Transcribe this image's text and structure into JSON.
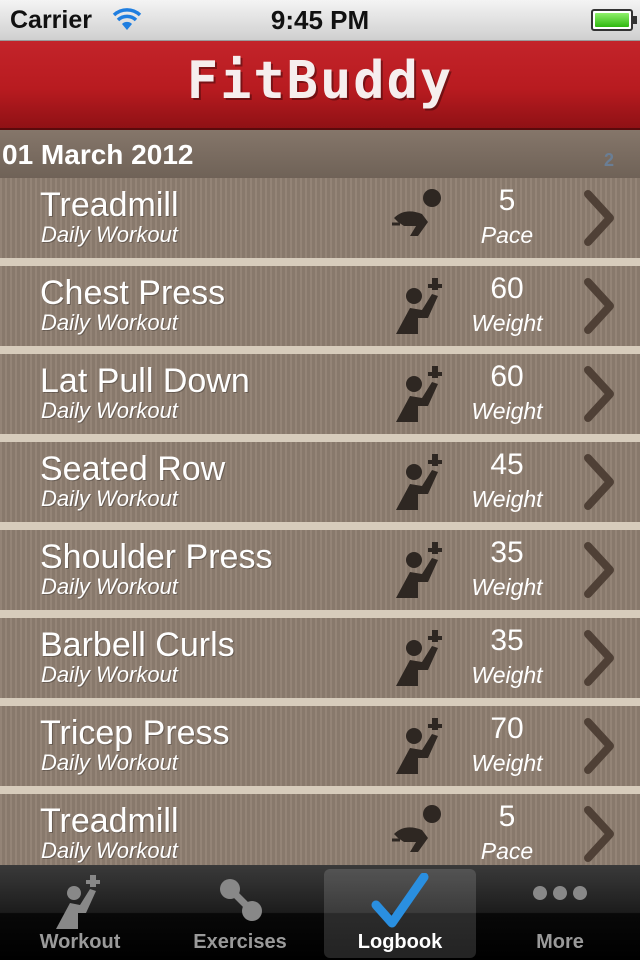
{
  "status_bar": {
    "carrier": "Carrier",
    "time": "9:45 PM"
  },
  "header": {
    "logo": "FitBuddy"
  },
  "section": {
    "date": "01 March 2012",
    "count": "2"
  },
  "rows": [
    {
      "title": "Treadmill",
      "subtitle": "Daily Workout",
      "value": "5",
      "unit": "Pace",
      "icon": "treadmill-icon"
    },
    {
      "title": "Chest Press",
      "subtitle": "Daily Workout",
      "value": "60",
      "unit": "Weight",
      "icon": "weights-icon"
    },
    {
      "title": "Lat Pull Down",
      "subtitle": "Daily Workout",
      "value": "60",
      "unit": "Weight",
      "icon": "weights-icon"
    },
    {
      "title": "Seated Row",
      "subtitle": "Daily Workout",
      "value": "45",
      "unit": "Weight",
      "icon": "weights-icon"
    },
    {
      "title": "Shoulder Press",
      "subtitle": "Daily Workout",
      "value": "35",
      "unit": "Weight",
      "icon": "weights-icon"
    },
    {
      "title": "Barbell Curls",
      "subtitle": "Daily Workout",
      "value": "35",
      "unit": "Weight",
      "icon": "weights-icon"
    },
    {
      "title": "Tricep Press",
      "subtitle": "Daily Workout",
      "value": "70",
      "unit": "Weight",
      "icon": "weights-icon"
    },
    {
      "title": "Treadmill",
      "subtitle": "Daily Workout",
      "value": "5",
      "unit": "Pace",
      "icon": "treadmill-icon"
    }
  ],
  "tabs": [
    {
      "label": "Workout",
      "icon": "workout-icon",
      "active": false
    },
    {
      "label": "Exercises",
      "icon": "dumbbell-icon",
      "active": false
    },
    {
      "label": "Logbook",
      "icon": "checkmark-icon",
      "active": true
    },
    {
      "label": "More",
      "icon": "more-dots-icon",
      "active": false
    }
  ],
  "colors": {
    "header_red": "#b81b20",
    "row_brown": "#8e7e70",
    "separator": "#d7ccbc",
    "tab_active_check": "#2a8fe0"
  }
}
